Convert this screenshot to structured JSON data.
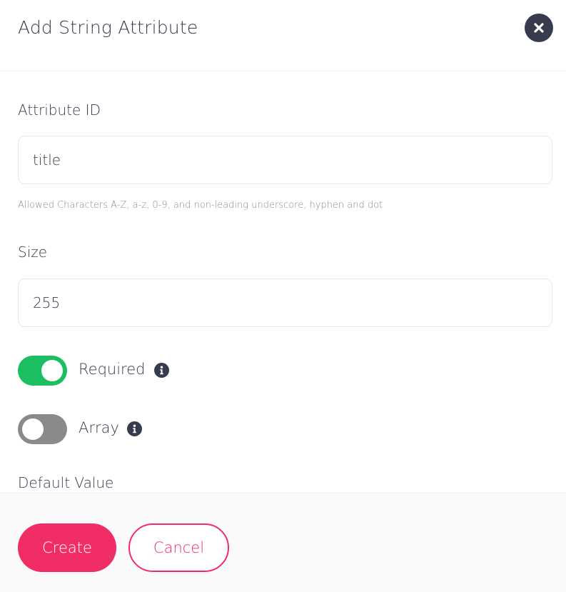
{
  "modal": {
    "title": "Add String Attribute",
    "close_icon": "close-icon"
  },
  "form": {
    "attribute_id": {
      "label": "Attribute ID",
      "value": "title",
      "hint": "Allowed Characters A-Z, a-z, 0-9, and non-leading underscore, hyphen and dot"
    },
    "size": {
      "label": "Size",
      "value": "255"
    },
    "required": {
      "label": "Required",
      "checked": true,
      "info_icon": "info-icon"
    },
    "array": {
      "label": "Array",
      "checked": false,
      "info_icon": "info-icon"
    },
    "default_value": {
      "label": "Default Value"
    }
  },
  "footer": {
    "create_label": "Create",
    "cancel_label": "Cancel"
  },
  "colors": {
    "accent": "#f02e65",
    "toggle_on": "#1bbf61",
    "toggle_off": "#8a8a8a",
    "text": "#373b4d"
  }
}
